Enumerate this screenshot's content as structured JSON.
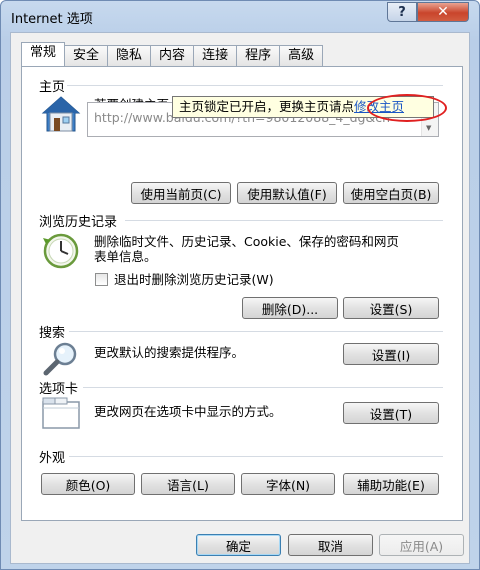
{
  "window": {
    "title": "Internet 选项",
    "help_label": "?",
    "close_label": "✕"
  },
  "tabs": [
    {
      "label": "常规",
      "active": true
    },
    {
      "label": "安全"
    },
    {
      "label": "隐私"
    },
    {
      "label": "内容"
    },
    {
      "label": "连接"
    },
    {
      "label": "程序"
    },
    {
      "label": "高级"
    }
  ],
  "homepage": {
    "section": "主页",
    "desc": "若要创建主页",
    "tooltip_text": "主页锁定已开启，更换主页请点",
    "tooltip_link": "修改主页",
    "url": "http://www.baidu.com/?tn=98012088_4_dg&ch",
    "btn_current": "使用当前页(C)",
    "btn_default": "使用默认值(F)",
    "btn_blank": "使用空白页(B)"
  },
  "history": {
    "section": "浏览历史记录",
    "desc_line1": "删除临时文件、历史记录、Cookie、保存的密码和网页",
    "desc_line2": "表单信息。",
    "checkbox_label": "退出时删除浏览历史记录(W)",
    "btn_delete": "删除(D)...",
    "btn_settings": "设置(S)"
  },
  "search": {
    "section": "搜索",
    "desc": "更改默认的搜索提供程序。",
    "btn_settings": "设置(I)"
  },
  "tabs_section": {
    "section": "选项卡",
    "desc": "更改网页在选项卡中显示的方式。",
    "btn_settings": "设置(T)"
  },
  "appearance": {
    "section": "外观",
    "btn_colors": "颜色(O)",
    "btn_languages": "语言(L)",
    "btn_fonts": "字体(N)",
    "btn_accessibility": "辅助功能(E)"
  },
  "footer": {
    "ok": "确定",
    "cancel": "取消",
    "apply": "应用(A)"
  }
}
